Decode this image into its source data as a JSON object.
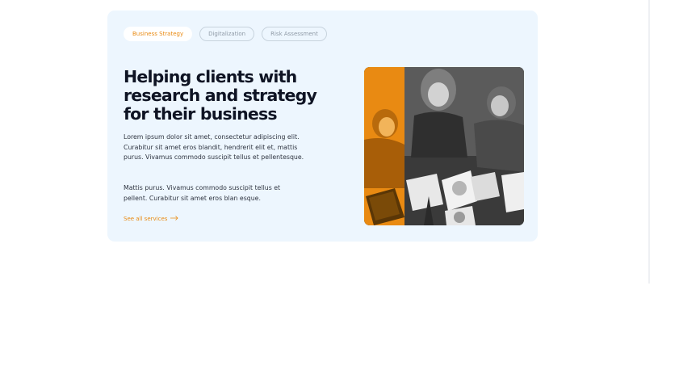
{
  "tabs": [
    {
      "label": "Business Strategy",
      "active": true
    },
    {
      "label": "Digitalization",
      "active": false
    },
    {
      "label": "Risk Assessment",
      "active": false
    }
  ],
  "headline": "Helping clients with research and strategy for their business",
  "paragraph_1": "Lorem ipsum dolor sit amet, consectetur adipiscing elit. Curabitur sit amet eros blandit, hendrerit elit et, mattis purus. Vivamus commodo suscipit tellus et pellentesque.",
  "paragraph_2": "Mattis purus. Vivamus commodo suscipit tellus et pellent. Curabitur sit amet eros blan esque.",
  "link": {
    "label": "See all services",
    "icon": "arrow-right-icon"
  },
  "colors": {
    "accent": "#e98a12",
    "card_bg": "#edf6fe",
    "heading": "#0f1424"
  }
}
